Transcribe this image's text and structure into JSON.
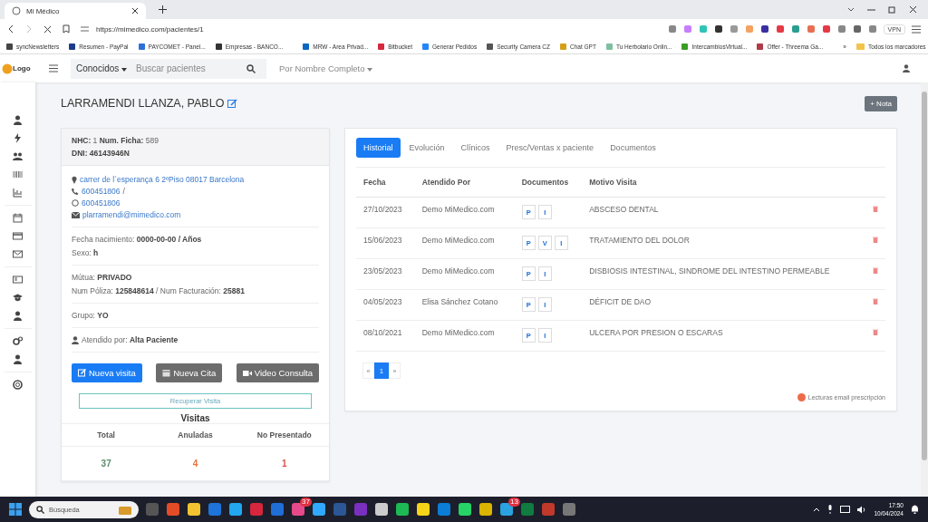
{
  "browser": {
    "tab_title": "Mi Médico",
    "url": "https://mimedico.com/pacientes/1",
    "vpn": "VPN",
    "bookmarks": [
      "syncNewsletters",
      "Resumen - PayPal",
      "PAYCOMET - Panel...",
      "Empresas - BANCO...",
      "MRW - Area Privad...",
      "Bitbucket",
      "Generar Pedidos",
      "Security Camera CZ",
      "Chat GPT",
      "Tu Herbolario Onlin...",
      "IntercambiosVirtual...",
      "Offer - Threema Ga..."
    ],
    "more": "»",
    "all_bookmarks": "Todos los marcadores"
  },
  "header": {
    "logo": "Logo",
    "filter": "Conocidos",
    "search_placeholder": "Buscar pacientes",
    "search_by": "Por Nombre Completo"
  },
  "patient": {
    "name": "LARRAMENDI LLANZA, PABLO",
    "note_button": "+ Nota"
  },
  "card": {
    "id_line": "**NHC:** 1  **Num. Ficha:** 589",
    "dni": "DNI: 46143946N",
    "contacts": [
      {
        "kind": "address",
        "text": "carrer de l´esperança 6 2ºPiso 08017 Barcelona"
      },
      {
        "kind": "phone",
        "text": "600451806",
        "suffix": "/"
      },
      {
        "kind": "whatsapp",
        "text": "600451806"
      },
      {
        "kind": "email",
        "text": "plarramendi@mimedico.com"
      }
    ],
    "sections": [
      [
        "Fecha nacimiento: **0000-00-00 / Años**",
        "Sexo: **h**"
      ],
      [
        "Mútua: **PRIVADO**",
        "Num Póliza: **125848614** / Num Facturación: **25881**"
      ],
      [
        "Grupo: **YO**"
      ]
    ],
    "attended": "Atendido por: **Alta Paciente**",
    "buttons": [
      {
        "kind": "primary",
        "label": "Nueva visita"
      },
      {
        "kind": "secondary",
        "label": "Nueva Cita"
      },
      {
        "kind": "secondary",
        "label": "Video Consulta"
      }
    ],
    "recover": "Recuperar Visita",
    "visits": {
      "title": "Visitas",
      "stats": [
        {
          "label": "Total",
          "value": "37",
          "color": "#5a8a6a"
        },
        {
          "label": "Anuladas",
          "value": "4",
          "color": "#e8743b"
        },
        {
          "label": "No Presentado",
          "value": "1",
          "color": "#d9534f"
        }
      ]
    }
  },
  "tabs": [
    {
      "label": "Historial",
      "selected": true
    },
    {
      "label": "Evolución",
      "selected": false
    },
    {
      "label": "Clínicos",
      "selected": false
    },
    {
      "label": "Presc/Ventas x paciente",
      "selected": false
    },
    {
      "label": "Documentos",
      "selected": false
    }
  ],
  "table": {
    "columns": [
      "Fecha",
      "Atendido Por",
      "Documentos",
      "Motivo Visita"
    ],
    "rows": [
      {
        "date": "27/10/2023",
        "by": "Demo MiMedico.com",
        "docs": [
          "P",
          "I"
        ],
        "reason": "ABSCESO DENTAL"
      },
      {
        "date": "15/06/2023",
        "by": "Demo MiMedico.com",
        "docs": [
          "P",
          "V",
          "I"
        ],
        "reason": "TRATAMIENTO DEL DOLOR"
      },
      {
        "date": "23/05/2023",
        "by": "Demo MiMedico.com",
        "docs": [
          "P",
          "I"
        ],
        "reason": "DISBIOSIS INTESTINAL, SINDROME DEL INTESTINO PERMEABLE"
      },
      {
        "date": "04/05/2023",
        "by": "Elisa Sánchez Cotano",
        "docs": [
          "P",
          "I"
        ],
        "reason": "DÉFICIT DE DAO"
      },
      {
        "date": "08/10/2021",
        "by": "Demo MiMedico.com",
        "docs": [
          "P",
          "I"
        ],
        "reason": "ULCERA POR PRESION O ESCARAS"
      }
    ]
  },
  "pagination": {
    "prev": "«",
    "pages": [
      {
        "label": "1",
        "selected": true
      }
    ],
    "next": "»"
  },
  "email_reads": "Lecturas email prescripción",
  "taskbar": {
    "search": "Búsqueda",
    "badges": [
      "37",
      "13"
    ],
    "time": "17:50",
    "date": "10/04/2024"
  }
}
